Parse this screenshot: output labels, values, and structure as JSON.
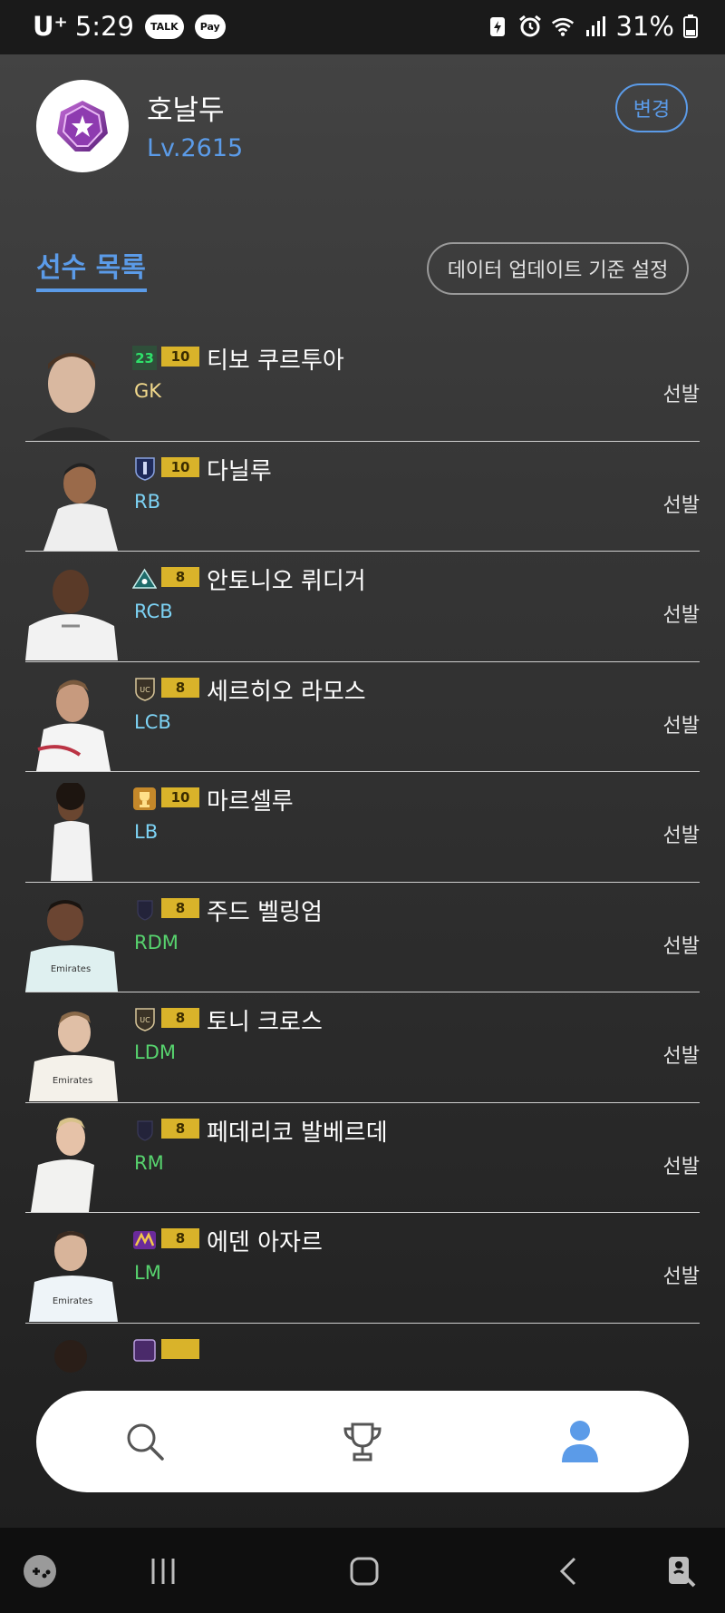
{
  "status_bar": {
    "carrier": "U⁺",
    "time": "5:29",
    "chips": [
      "TALK",
      "Pay"
    ],
    "battery": "31%"
  },
  "profile": {
    "name": "호날두",
    "level": "Lv.2615",
    "change_label": "변경"
  },
  "section": {
    "title": "선수 목록",
    "data_update_label": "데이터 업데이트 기준 설정"
  },
  "players": [
    {
      "season_badge": "23",
      "grade": "10",
      "name": "티보 쿠르투아",
      "position": "GK",
      "status": "선발"
    },
    {
      "season_badge": "",
      "grade": "10",
      "name": "다닐루",
      "position": "RB",
      "status": "선발"
    },
    {
      "season_badge": "",
      "grade": "8",
      "name": "안토니오 뤼디거",
      "position": "RCB",
      "status": "선발"
    },
    {
      "season_badge": "",
      "grade": "8",
      "name": "세르히오 라모스",
      "position": "LCB",
      "status": "선발"
    },
    {
      "season_badge": "",
      "grade": "10",
      "name": "마르셀루",
      "position": "LB",
      "status": "선발"
    },
    {
      "season_badge": "",
      "grade": "8",
      "name": "주드 벨링엄",
      "position": "RDM",
      "status": "선발"
    },
    {
      "season_badge": "",
      "grade": "8",
      "name": "토니 크로스",
      "position": "LDM",
      "status": "선발"
    },
    {
      "season_badge": "",
      "grade": "8",
      "name": "페데리코 발베르데",
      "position": "RM",
      "status": "선발"
    },
    {
      "season_badge": "",
      "grade": "8",
      "name": "에덴 아자르",
      "position": "LM",
      "status": "선발"
    }
  ],
  "icons": {
    "nav": [
      "search-icon",
      "trophy-icon",
      "user-icon"
    ],
    "system": [
      "game-launcher-icon",
      "recent-apps-icon",
      "home-icon",
      "back-icon",
      "accessibility-icon"
    ]
  },
  "colors": {
    "accent": "#5b9be8",
    "grade_badge": "#d9b32a",
    "pos_gk": "#f2d98c",
    "pos_defender": "#7dd3f5",
    "pos_midfielder": "#57d36e"
  }
}
